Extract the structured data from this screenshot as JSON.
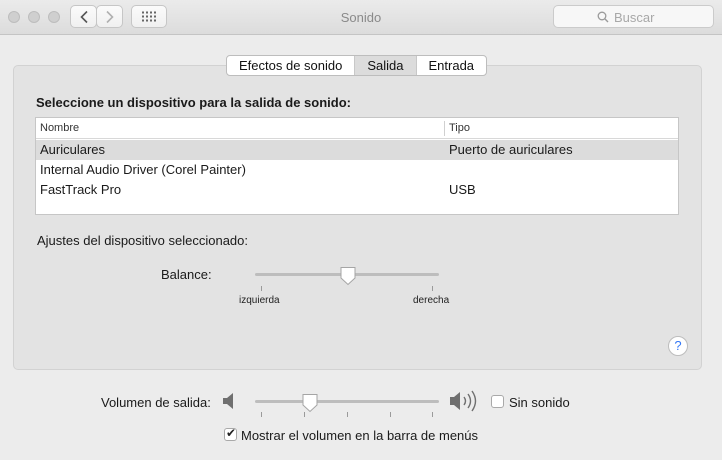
{
  "window": {
    "title": "Sonido"
  },
  "search": {
    "placeholder": "Buscar"
  },
  "tabs": [
    {
      "label": "Efectos de sonido",
      "selected": false
    },
    {
      "label": "Salida",
      "selected": true
    },
    {
      "label": "Entrada",
      "selected": false
    }
  ],
  "output": {
    "heading": "Seleccione un dispositivo para la salida de sonido:",
    "columns": [
      "Nombre",
      "Tipo"
    ],
    "devices": [
      {
        "name": "Auriculares",
        "type": "Puerto de auriculares",
        "selected": true
      },
      {
        "name": "Internal Audio Driver (Corel Painter)",
        "type": "",
        "selected": false
      },
      {
        "name": "FastTrack Pro",
        "type": "USB",
        "selected": false
      }
    ]
  },
  "device_settings": {
    "label": "Ajustes del dispositivo seleccionado:",
    "balance_label": "Balance:",
    "balance_left": "izquierda",
    "balance_right": "derecha",
    "balance_value": 0.5
  },
  "help": {
    "symbol": "?"
  },
  "volume": {
    "label": "Volumen de salida:",
    "value": 0.28,
    "mute_label": "Sin sonido",
    "mute_checked": false
  },
  "menubar": {
    "label": "Mostrar el volumen en la barra de menús",
    "checked": true
  },
  "colors": {
    "accent": "#3478f6",
    "selection": "#dcdcdc"
  }
}
